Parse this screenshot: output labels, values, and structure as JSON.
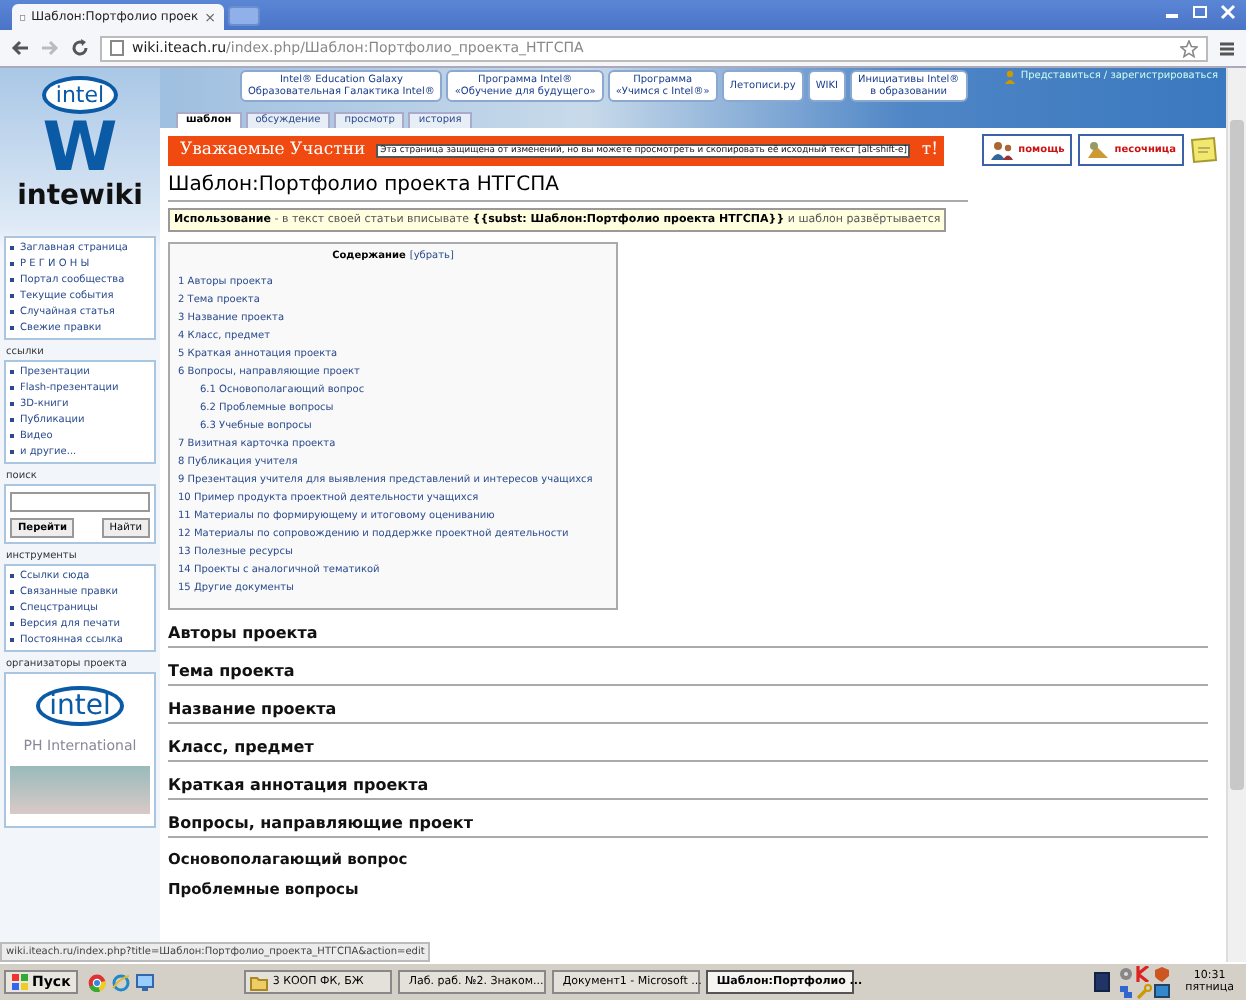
{
  "browser": {
    "tab_title": "Шаблон:Портфолио проек",
    "tab_close": "×",
    "host": "wiki.iteach.ru",
    "path": "/index.php/Шаблон:Портфолио_проекта_НТГСПА",
    "status_url": "wiki.iteach.ru/index.php?title=Шаблон:Портфолио_проекта_НТГСПА&action=edit"
  },
  "site": {
    "logo": "intel",
    "letter": "W",
    "wordmark": "intewiki",
    "user_link": "Представиться / зарегистрироваться",
    "nav_buttons": [
      {
        "lines": [
          "Intel® Education Galaxy",
          "Образовательная Галактика Intel®"
        ]
      },
      {
        "lines": [
          "Программа Intel®",
          "«Обучение для будущего»"
        ]
      },
      {
        "lines": [
          "Программа",
          "«Учимся с Intel®»"
        ]
      },
      {
        "lines": [
          "Летописи.ру"
        ]
      },
      {
        "lines": [
          "WIKI"
        ]
      },
      {
        "lines": [
          "Инициативы Intel®",
          "в образовании"
        ]
      }
    ],
    "page_tabs": [
      {
        "label": "шаблон",
        "selected": true
      },
      {
        "label": "обсуждение",
        "selected": false
      },
      {
        "label": "просмотр",
        "selected": false
      },
      {
        "label": "история",
        "selected": false
      }
    ]
  },
  "sidebar": [
    {
      "kind": "links",
      "items": [
        "Заглавная страница",
        "Р Е Г И О Н Ы",
        "Портал сообщества",
        "Текущие события",
        "Случайная статья",
        "Свежие правки"
      ]
    },
    {
      "kind": "links",
      "title": "ссылки",
      "items": [
        "Презентации",
        "Flash-презентации",
        "3D-книги",
        "Публикации",
        "Видео",
        "и другие..."
      ]
    },
    {
      "kind": "search",
      "title": "поиск",
      "buttons": [
        "Перейти",
        "Найти"
      ]
    },
    {
      "kind": "links",
      "title": "инструменты",
      "items": [
        "Ссылки сюда",
        "Связанные правки",
        "Спецстраницы",
        "Версия для печати",
        "Постоянная ссылка"
      ]
    },
    {
      "kind": "sponsors",
      "title": "организаторы проекта",
      "logos": [
        "intel",
        "PH International"
      ]
    }
  ],
  "notice": {
    "text": "Уважаемые Участни",
    "tail": "т!",
    "tooltip": "Эта страница защищена от изменений, но вы можете просмотреть и скопировать её исходный текст [alt-shift-e]"
  },
  "help_buttons": [
    "помощь",
    "песочница"
  ],
  "title": "Шаблон:Портфолио проекта НТГСПА",
  "usage": "**Использование** - в текст своей статьи вписывате **{{subst: Шаблон:Портфолио проекта НТГСПА}}** и шаблон развёртывается",
  "toc": {
    "title": "Содержание",
    "toggle": "[убрать]",
    "items": [
      {
        "number": "1",
        "text": "Авторы проекта"
      },
      {
        "number": "2",
        "text": "Тема проекта"
      },
      {
        "number": "3",
        "text": "Название проекта"
      },
      {
        "number": "4",
        "text": "Класс, предмет"
      },
      {
        "number": "5",
        "text": "Краткая аннотация проекта"
      },
      {
        "number": "6",
        "text": "Вопросы, направляющие проект",
        "children": [
          {
            "number": "6.1",
            "text": "Основополагающий вопрос"
          },
          {
            "number": "6.2",
            "text": "Проблемные вопросы"
          },
          {
            "number": "6.3",
            "text": "Учебные вопросы"
          }
        ]
      },
      {
        "number": "7",
        "text": "Визитная карточка проекта"
      },
      {
        "number": "8",
        "text": "Публикация учителя"
      },
      {
        "number": "9",
        "text": "Презентация учителя для выявления представлений и интересов учащихся"
      },
      {
        "number": "10",
        "text": "Пример продукта проектной деятельности учащихся"
      },
      {
        "number": "11",
        "text": "Материалы по формирующему и итоговому оцениванию"
      },
      {
        "number": "12",
        "text": "Материалы по сопровождению и поддержке проектной деятельности"
      },
      {
        "number": "13",
        "text": "Полезные ресурсы"
      },
      {
        "number": "14",
        "text": "Проекты с аналогичной тематикой"
      },
      {
        "number": "15",
        "text": "Другие документы"
      }
    ]
  },
  "sections": [
    {
      "kind": "h2",
      "text": "Авторы проекта"
    },
    {
      "kind": "h2",
      "text": "Тема проекта"
    },
    {
      "kind": "h2",
      "text": "Название проекта"
    },
    {
      "kind": "h2",
      "text": "Класс, предмет"
    },
    {
      "kind": "h2",
      "text": "Краткая аннотация проекта"
    },
    {
      "kind": "h2",
      "text": "Вопросы, направляющие проект"
    },
    {
      "kind": "h3",
      "text": "Основополагающий вопрос"
    },
    {
      "kind": "h3",
      "text": "Проблемные вопросы"
    }
  ],
  "taskbar": {
    "start": "Пуск",
    "tasks": [
      {
        "label": "3 КООП ФК, БЖ",
        "kind": "folder",
        "selected": false
      },
      {
        "label": "Лаб. раб. №2. Знаком...",
        "kind": "doc",
        "selected": false
      },
      {
        "label": "Документ1 - Microsoft ...",
        "kind": "doc",
        "selected": false
      },
      {
        "label": "Шаблон:Портфолио ...",
        "kind": "browser",
        "selected": true
      }
    ],
    "time": "10:31",
    "day": "пятница"
  }
}
